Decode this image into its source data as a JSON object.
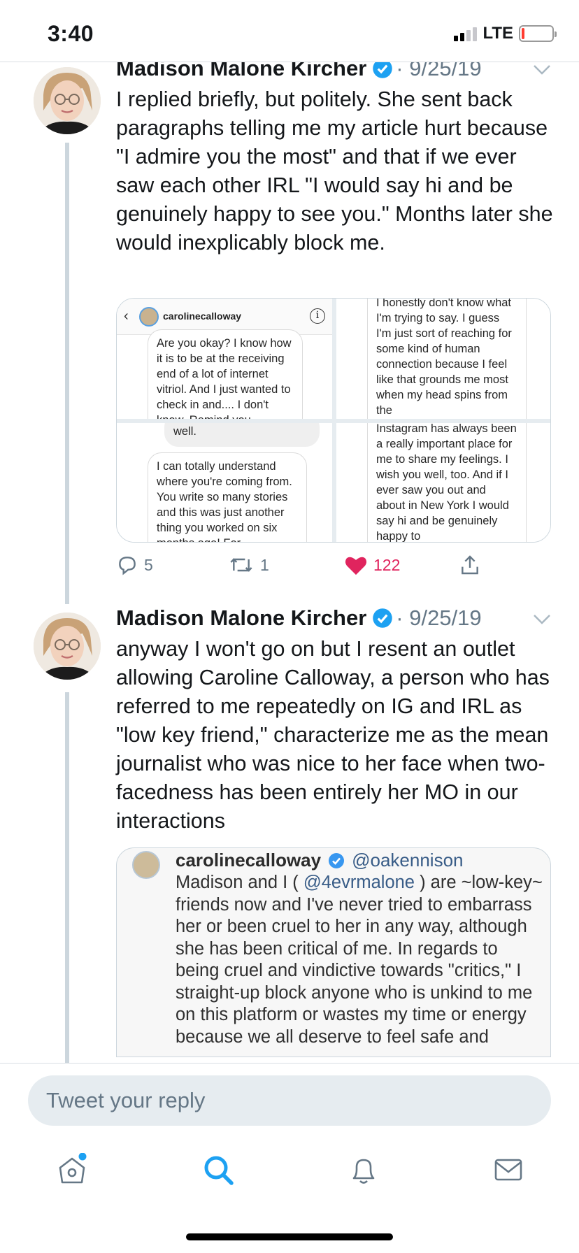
{
  "status_bar": {
    "time": "3:40",
    "network": "LTE",
    "battery_color": "#ff3b30"
  },
  "tweets": [
    {
      "name": "Madison Malone Kircher",
      "date": "· 9/25/19",
      "text": "I replied briefly, but politely. She sent back paragraphs telling me my article hurt because \"I admire you the most\" and that if we ever saw each other IRL \"I would say hi and be genuinely happy to see you.\" Months later she would inexplicably block me.",
      "media": {
        "top_left": {
          "username": "carolinecalloway",
          "message": "Are you okay? I know how it is to be at the receiving end of a lot of internet vitriol. And I just wanted to check in and.... I don't know. Remind you"
        },
        "top_right": {
          "message": "I honestly don't know what I'm trying to say. I guess I'm just sort of reaching for some kind of human connection because I feel like that grounds me most when my head spins from the"
        },
        "bottom_left": {
          "gray_message": "well.",
          "message": "I can totally understand where you're coming from. You write so many stories and this was just another thing you worked on six months ago! For"
        },
        "bottom_right": {
          "message": "Instagram has always been a really important place for me to share my feelings. I wish you well, too. And if I ever saw you out and about in New York I would say hi and be genuinely happy to"
        }
      },
      "actions": {
        "replies": "5",
        "retweets": "1",
        "likes": "122"
      }
    },
    {
      "name": "Madison Malone Kircher",
      "date": "· 9/25/19",
      "text": "anyway I won't go on but I resent an outlet allowing Caroline Calloway, a person who has referred to me repeatedly on IG and IRL as \"low key friend,\" characterize me as the mean journalist who was nice to her face when two-facedness has been entirely her MO in our interactions",
      "quote": {
        "username": "carolinecalloway",
        "handle": "@oakennison",
        "text_before": "Madison and I ( ",
        "mention": "@4evrmalone",
        "text_after": " ) are ~low-key~ friends now and I've never tried to embarrass her or been cruel to her in any way, although she has been critical of me. In regards to being cruel and vindictive towards \"critics,\" I straight-up block anyone who is unkind to me on this platform or wastes my time or energy because we all deserve to feel safe and"
      }
    }
  ],
  "reply": {
    "placeholder": "Tweet your reply"
  },
  "tab_bar": {
    "icons": [
      "home-icon",
      "search-icon",
      "notifications-icon",
      "messages-icon"
    ],
    "active_color": "#1da1f2",
    "inactive_color": "#657786",
    "notification_dot": true
  },
  "colors": {
    "like": "#e0245e",
    "verified": "#1da1f2",
    "muted": "#657786"
  }
}
